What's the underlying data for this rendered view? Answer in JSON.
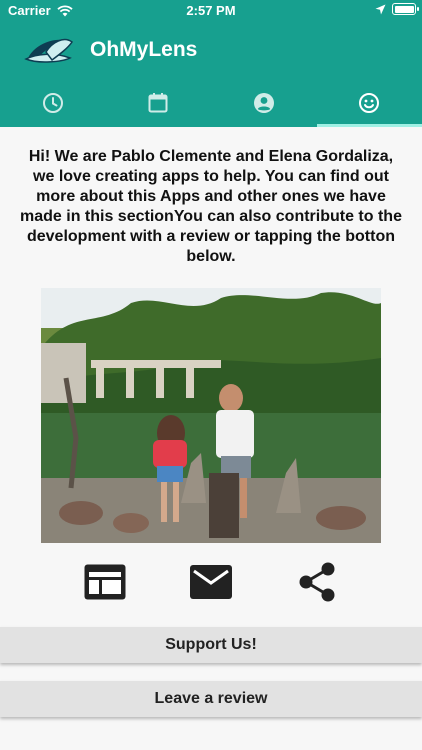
{
  "status_bar": {
    "carrier": "Carrier",
    "time": "2:57 PM"
  },
  "app": {
    "title": "OhMyLens"
  },
  "tabs": [
    {
      "icon": "clock-icon",
      "active": false
    },
    {
      "icon": "calendar-icon",
      "active": false
    },
    {
      "icon": "account-icon",
      "active": false
    },
    {
      "icon": "smiley-icon",
      "active": true
    }
  ],
  "about": {
    "intro": "Hi! We are Pablo Clemente and Elena Gordaliza, we love creating apps to help. You can find out more about this Apps and other ones we have made in this sectionYou can also contribute to the development with a review or tapping the botton below."
  },
  "actions": [
    {
      "icon": "web-icon"
    },
    {
      "icon": "email-icon"
    },
    {
      "icon": "share-icon"
    }
  ],
  "buttons": {
    "support_label": "Support Us!",
    "review_label": "Leave a review"
  },
  "colors": {
    "primary": "#17a08f",
    "tab_indicator": "#9ff0e4",
    "button_bg": "#e2e2e2",
    "background": "#f7f7f7"
  }
}
